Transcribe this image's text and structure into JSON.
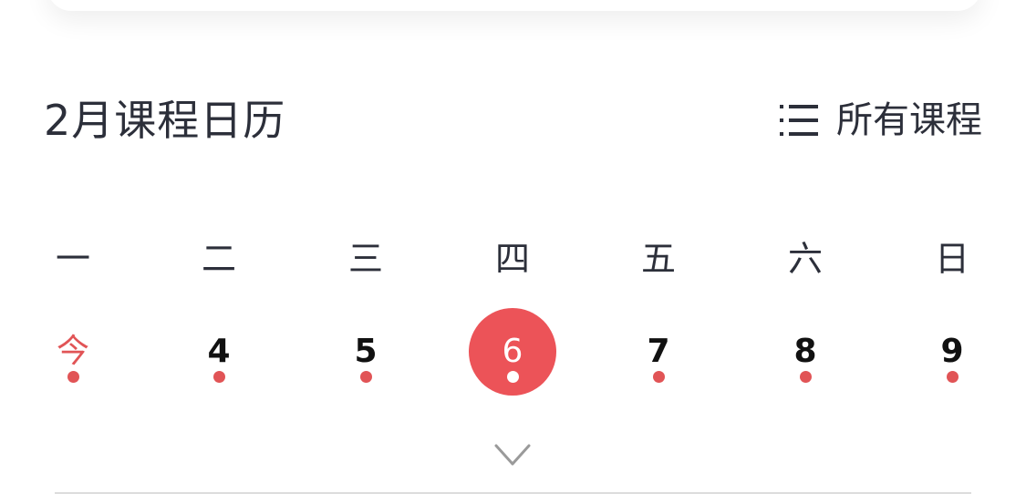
{
  "calendar": {
    "title": "2月课程日历",
    "all_courses_label": "所有课程",
    "all_courses_icon": "list-icon",
    "expand_icon": "chevron-down-icon",
    "weekdays": [
      "一",
      "二",
      "三",
      "四",
      "五",
      "六",
      "日"
    ],
    "days": [
      {
        "label": "今",
        "today": true,
        "selected": false,
        "has_course": true
      },
      {
        "label": "4",
        "today": false,
        "selected": false,
        "has_course": true
      },
      {
        "label": "5",
        "today": false,
        "selected": false,
        "has_course": true
      },
      {
        "label": "6",
        "today": false,
        "selected": true,
        "has_course": true
      },
      {
        "label": "7",
        "today": false,
        "selected": false,
        "has_course": true
      },
      {
        "label": "8",
        "today": false,
        "selected": false,
        "has_course": true
      },
      {
        "label": "9",
        "today": false,
        "selected": false,
        "has_course": true
      }
    ]
  },
  "colors": {
    "accent": "#ec5358",
    "text": "#2c2f3a",
    "date_text": "#111111",
    "divider": "#dcdcdc"
  }
}
